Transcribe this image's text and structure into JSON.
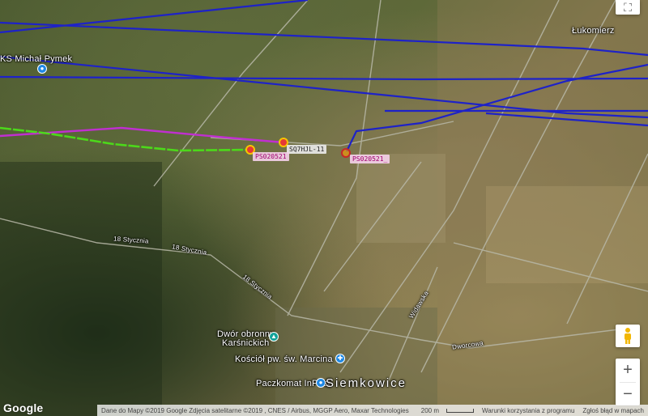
{
  "map": {
    "place_labels": {
      "lukomierz": "Łukomierz",
      "michal": "KS Michał Pymek",
      "road_18_1": "18 Stycznia",
      "road_18_2": "18 Stycznia",
      "widawska": "Widawska",
      "dworcowa": "Dworcowa",
      "dwor": "Dwór obronny",
      "dwor2": "Karśnickich",
      "kosciol": "Kościół pw. św. Marcina",
      "paczkomat": "Paczkomat InPost",
      "siemkowice": "Siemkowice"
    },
    "track_labels": {
      "callsign_grey": "SQ7HJL-11",
      "callsign_pink_1": "PS020521",
      "callsign_pink_2": "PS020521_"
    },
    "icons": {
      "poi": "pin-icon",
      "church": "church-icon",
      "balloon": "balloon-marker-icon"
    },
    "colors": {
      "track_blue": "#1e22c8",
      "track_magenta": "#c02fd0",
      "track_green": "#4cd91a"
    }
  },
  "controls": {
    "fullscreen_icon": "fullscreen-icon",
    "pegman_icon": "pegman-icon",
    "zoom_in": "+",
    "zoom_out": "−"
  },
  "footer": {
    "logo": "Google",
    "attribution": "Dane do Mapy ©2019 Google Zdjęcia satelitarne ©2019 , CNES / Airbus, MGGP Aero, Maxar Technologies",
    "scale": "200 m",
    "terms": "Warunki korzystania z programu",
    "report": "Zgłoś błąd w mapach"
  }
}
